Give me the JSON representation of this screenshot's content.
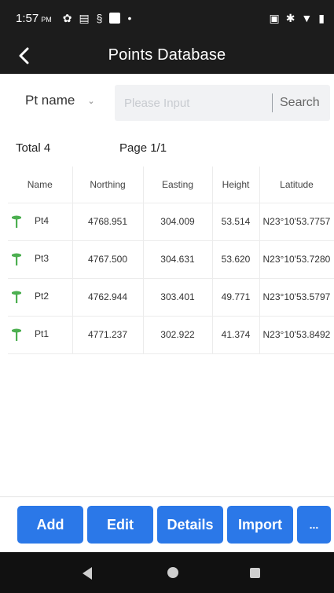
{
  "status_bar": {
    "time": "1:57",
    "ampm": "PM",
    "icons_left": [
      "gear-icon",
      "message-icon",
      "app-icon",
      "white-square-icon",
      "dot-icon"
    ],
    "icons_right": [
      "cast-icon",
      "bluetooth-icon",
      "wifi-icon",
      "battery-icon"
    ]
  },
  "app_bar": {
    "title": "Points Database",
    "back_icon": "chevron-left-icon"
  },
  "search": {
    "filter_label": "Pt name",
    "placeholder": "Please Input",
    "value": "",
    "button_label": "Search"
  },
  "pager": {
    "total": "Total 4",
    "page": "Page 1/1"
  },
  "table": {
    "headers": [
      "Name",
      "Northing",
      "Easting",
      "Height",
      "Latitude"
    ],
    "rows": [
      {
        "name": "Pt4",
        "northing": "4768.951",
        "easting": "304.009",
        "height": "53.514",
        "latitude": "N23°10'53.7757"
      },
      {
        "name": "Pt3",
        "northing": "4767.500",
        "easting": "304.631",
        "height": "53.620",
        "latitude": "N23°10'53.7280"
      },
      {
        "name": "Pt2",
        "northing": "4762.944",
        "easting": "303.401",
        "height": "49.771",
        "latitude": "N23°10'53.5797"
      },
      {
        "name": "Pt1",
        "northing": "4771.237",
        "easting": "302.922",
        "height": "41.374",
        "latitude": "N23°10'53.8492"
      }
    ],
    "row_icon": "survey-pin-icon"
  },
  "actions": {
    "add": "Add",
    "edit": "Edit",
    "details": "Details",
    "import": "Import",
    "more": "..."
  },
  "colors": {
    "accent": "#2b78e8",
    "bar": "#1c1c1c",
    "pin": "#4caf50"
  }
}
